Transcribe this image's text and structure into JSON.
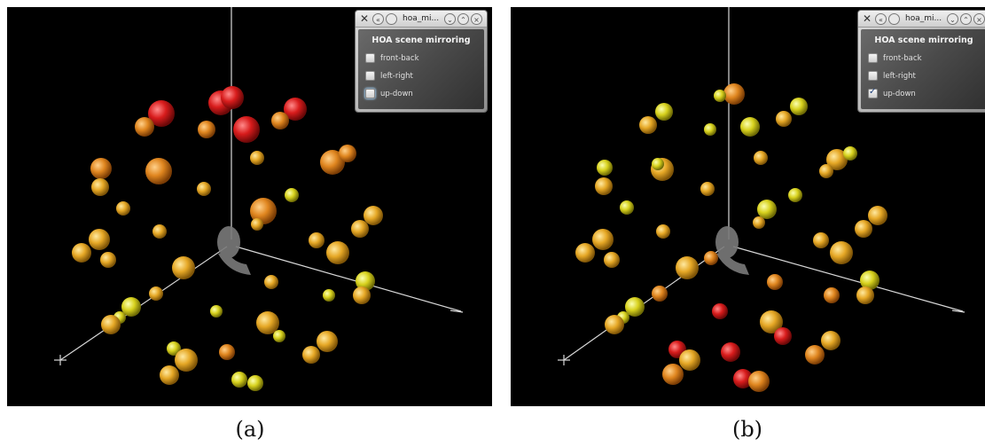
{
  "panels": [
    {
      "caption": "(a)",
      "window": {
        "title": "hoa_mi...",
        "heading": "HOA scene mirroring",
        "options": [
          {
            "label": "front-back",
            "checked": false
          },
          {
            "label": "left-right",
            "checked": false
          },
          {
            "label": "up-down",
            "checked": false
          }
        ]
      }
    },
    {
      "caption": "(b)",
      "window": {
        "title": "hoa_mi...",
        "heading": "HOA scene mirroring",
        "options": [
          {
            "label": "front-back",
            "checked": false
          },
          {
            "label": "left-right",
            "checked": false
          },
          {
            "label": "up-down",
            "checked": true
          }
        ]
      }
    }
  ],
  "colors": {
    "background": "#000000",
    "red": "#d81c1c",
    "orange": "#e08a1f",
    "amber": "#e6a826",
    "yellow": "#d8d21e",
    "head": "#7a7a7a",
    "axis": "#d8d8d8"
  },
  "icons": [
    "app-icon",
    "shade-icon",
    "menu-icon",
    "minimize-icon",
    "maximize-icon",
    "close-icon"
  ]
}
